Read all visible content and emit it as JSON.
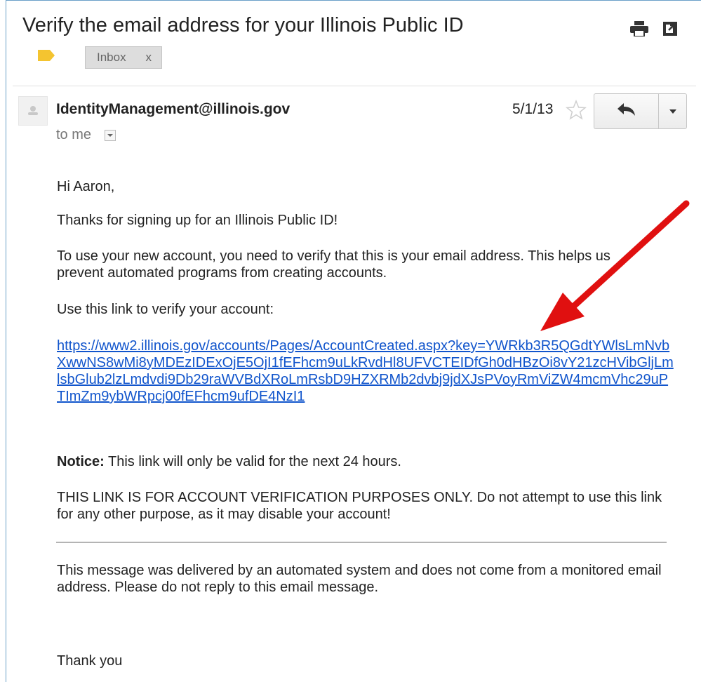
{
  "header": {
    "subject": "Verify the email address for your Illinois Public ID",
    "label_chip": "Inbox",
    "label_chip_close": "x"
  },
  "icons": {
    "print": "printer-icon",
    "popout": "new-window-icon",
    "label": "label-tag-icon",
    "star": "star-icon",
    "reply": "reply-arrow-icon",
    "more": "dropdown-caret-icon",
    "avatar": "person-avatar-icon"
  },
  "message": {
    "sender": "IdentityManagement@illinois.gov",
    "to": "to me",
    "date": "5/1/13",
    "greeting": "Hi Aaron,",
    "thanks": "Thanks for signing up for an Illinois Public ID!",
    "verify_paragraph": "To use your new account, you need to verify that this is your email address. This helps us prevent automated programs from creating accounts.",
    "use_link": "Use this link to verify your account:",
    "link": "https://www2.illinois.gov/accounts/Pages/AccountCreated.aspx?key=YWRkb3R5QGdtYWlsLmNvbXwwNS8wMi8yMDEzIDExOjE5OjI1fEFhcm9uLkRvdHl8UFVCTEIDfGh0dHBzOi8vY21zcHVibGljLmlsbGlub2lzLmdvdi9Db29raWVBdXRoLmRsbD9HZXRMb2dvbj9jdXJsPVoyRmViZW4mcmVhc29uPTImZm9ybWRpcj00fEFhcm9ufDE4NzI1",
    "notice_label": "Notice:",
    "notice_text": " This link will only be valid for the next 24 hours.",
    "warning": "THIS LINK IS FOR ACCOUNT VERIFICATION PURPOSES ONLY. Do not attempt to use this link for any other purpose, as it may disable your account!",
    "automated": "This message was delivered by an automated system and does not come from a monitored email address. Please do not reply to this email message.",
    "closing": "Thank you"
  },
  "colors": {
    "link": "#1155cc",
    "annotation_arrow": "#e01010",
    "label_tag": "#f4c430",
    "frame_border": "#6aa0c8"
  }
}
